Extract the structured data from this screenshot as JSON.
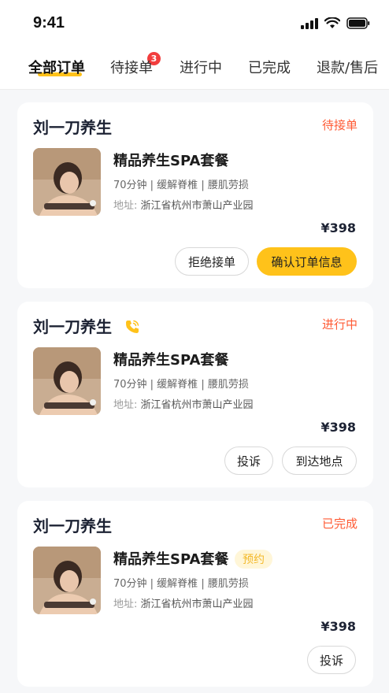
{
  "status_bar": {
    "time": "9:41"
  },
  "tabs": [
    {
      "label": "全部订单",
      "active": true
    },
    {
      "label": "待接单",
      "badge": "3"
    },
    {
      "label": "进行中"
    },
    {
      "label": "已完成"
    },
    {
      "label": "退款/售后"
    }
  ],
  "colors": {
    "accent": "#ffc21a",
    "status": "#ff5b35",
    "badge": "#f23d3d"
  },
  "orders": [
    {
      "shop": "刘一刀养生",
      "status": "待接单",
      "title": "精品养生SPA套餐",
      "tags": "70分钟 | 缓解脊椎 | 腰肌劳损",
      "address_label": "地址:",
      "address": "浙江省杭州市萧山产业园",
      "price": "¥398",
      "buttons": [
        "拒绝接单",
        "确认订单信息"
      ]
    },
    {
      "shop": "刘一刀养生",
      "status": "进行中",
      "title": "精品养生SPA套餐",
      "tags": "70分钟 | 缓解脊椎 | 腰肌劳损",
      "address_label": "地址:",
      "address": "浙江省杭州市萧山产业园",
      "price": "¥398",
      "buttons": [
        "投诉",
        "到达地点"
      ]
    },
    {
      "shop": "刘一刀养生",
      "status": "已完成",
      "title": "精品养生SPA套餐",
      "tag": "预约",
      "tags": "70分钟 | 缓解脊椎 | 腰肌劳损",
      "address_label": "地址:",
      "address": "浙江省杭州市萧山产业园",
      "price": "¥398",
      "buttons": [
        "投诉"
      ]
    }
  ]
}
